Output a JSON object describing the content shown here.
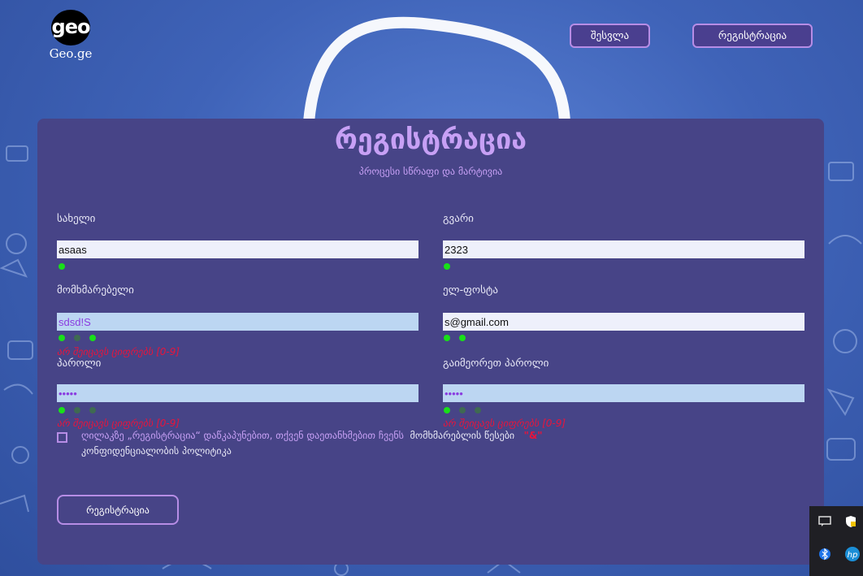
{
  "header": {
    "logo_mark": "geo",
    "logo_text": "Geo.ge",
    "login_label": "შესვლა",
    "register_label": "რეგისტრაცია"
  },
  "form": {
    "title": "რეგისტრაცია",
    "subtitle": "პროცესი სწრაფი და მარტივია",
    "first_name": {
      "label": "სახელი",
      "value": "asaas"
    },
    "last_name": {
      "label": "გვარი",
      "value": "2323"
    },
    "username": {
      "label": "მომხმარებელი",
      "value": "sdsd!S",
      "error": "არ შეიცავს ციფრებს [0-9]"
    },
    "email": {
      "label": "ელ-ფოსტა",
      "value": "s@gmail.com"
    },
    "password": {
      "label": "პაროლი",
      "value": "•••••",
      "error": "არ შეიცავს ციფრებს [0-9]"
    },
    "confirm_password": {
      "label": "გაიმეორეთ პაროლი",
      "value": "•••••",
      "error": "არ შეიცავს ციფრებს [0-9]"
    },
    "terms_prefix": "ღილაკზე „რეგისტრაცია“ დაწკაპუნებით, თქვენ დაეთანხმებით ჩვენს",
    "terms_link": "მომხმარებლის წესები",
    "terms_amp": "\"&\"",
    "terms_policy": "კონფიდენციალობის პოლიტიკა",
    "submit_label": "რეგისტრაცია"
  },
  "colors": {
    "accent": "#c7a0f5",
    "card": "#474487",
    "error": "#e8143c",
    "valid": "#19e019"
  }
}
